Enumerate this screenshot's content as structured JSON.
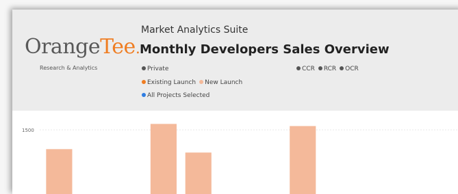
{
  "header": {
    "logo_main": "Orange",
    "logo_accent": "Tee",
    "logo_dot": ".",
    "logo_subtitle": "Research & Analytics",
    "suite": "Market Analytics Suite",
    "title": "Monthly Developers Sales Overview"
  },
  "filters": {
    "sector_label": "Private",
    "region_items": [
      {
        "label": "CCR",
        "color": "#555555"
      },
      {
        "label": "RCR",
        "color": "#555555"
      },
      {
        "label": "OCR",
        "color": "#555555"
      }
    ],
    "launch_items": [
      {
        "label": "Existing Launch",
        "color": "#ef7d22"
      },
      {
        "label": "New Launch",
        "color": "#f4b99a"
      }
    ],
    "projects_label": "All Projects Selected",
    "colors": {
      "private": "#555555",
      "projects": "#2f7de1"
    }
  },
  "chart_data": {
    "type": "bar",
    "ytick_labels": [
      "1500"
    ],
    "yticks": [
      1500
    ],
    "ylim": [
      0,
      1950
    ],
    "bar_color": "#f4b99a",
    "bars": [
      {
        "slot": 0,
        "value": 1050
      },
      {
        "slot": 3,
        "value": 1640
      },
      {
        "slot": 4,
        "value": 970
      },
      {
        "slot": 7,
        "value": 1590
      }
    ],
    "slot_count": 12
  }
}
